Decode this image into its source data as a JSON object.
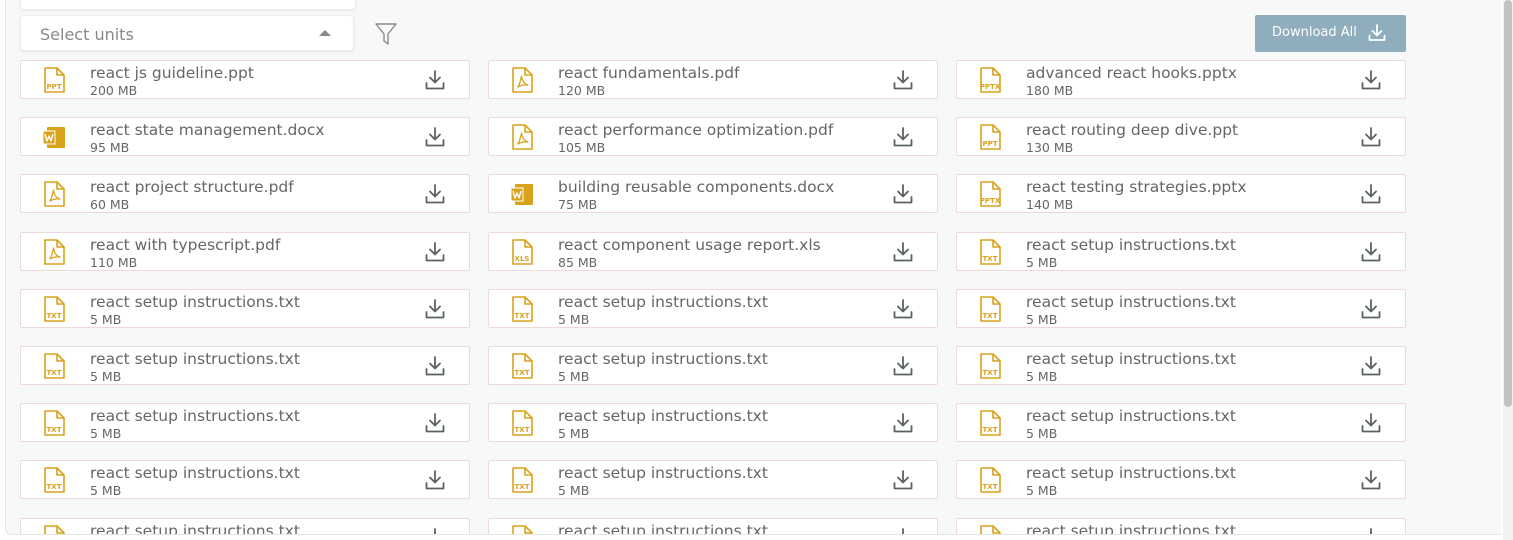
{
  "toolbar": {
    "select_placeholder": "Select units",
    "download_all_label": "Download All",
    "filter_icon": "filter-icon"
  },
  "colors": {
    "accent_button": "#8fadbc",
    "file_icon": "#d9a21b",
    "card_border": "#eed9da",
    "text": "#666666"
  },
  "files": [
    {
      "name": "react js guideline.ppt",
      "size": "200 MB",
      "type": "ppt"
    },
    {
      "name": "react fundamentals.pdf",
      "size": "120 MB",
      "type": "pdf"
    },
    {
      "name": "advanced react hooks.pptx",
      "size": "180 MB",
      "type": "pptx"
    },
    {
      "name": "react state management.docx",
      "size": "95 MB",
      "type": "docx"
    },
    {
      "name": "react performance optimization.pdf",
      "size": "105 MB",
      "type": "pdf"
    },
    {
      "name": "react routing deep dive.ppt",
      "size": "130 MB",
      "type": "ppt"
    },
    {
      "name": "react project structure.pdf",
      "size": "60 MB",
      "type": "pdf"
    },
    {
      "name": "building reusable components.docx",
      "size": "75 MB",
      "type": "docx"
    },
    {
      "name": "react testing strategies.pptx",
      "size": "140 MB",
      "type": "pptx"
    },
    {
      "name": "react with typescript.pdf",
      "size": "110 MB",
      "type": "pdf"
    },
    {
      "name": "react component usage report.xls",
      "size": "85 MB",
      "type": "xls"
    },
    {
      "name": "react setup instructions.txt",
      "size": "5 MB",
      "type": "txt"
    },
    {
      "name": "react setup instructions.txt",
      "size": "5 MB",
      "type": "txt"
    },
    {
      "name": "react setup instructions.txt",
      "size": "5 MB",
      "type": "txt"
    },
    {
      "name": "react setup instructions.txt",
      "size": "5 MB",
      "type": "txt"
    },
    {
      "name": "react setup instructions.txt",
      "size": "5 MB",
      "type": "txt"
    },
    {
      "name": "react setup instructions.txt",
      "size": "5 MB",
      "type": "txt"
    },
    {
      "name": "react setup instructions.txt",
      "size": "5 MB",
      "type": "txt"
    },
    {
      "name": "react setup instructions.txt",
      "size": "5 MB",
      "type": "txt"
    },
    {
      "name": "react setup instructions.txt",
      "size": "5 MB",
      "type": "txt"
    },
    {
      "name": "react setup instructions.txt",
      "size": "5 MB",
      "type": "txt"
    },
    {
      "name": "react setup instructions.txt",
      "size": "5 MB",
      "type": "txt"
    },
    {
      "name": "react setup instructions.txt",
      "size": "5 MB",
      "type": "txt"
    },
    {
      "name": "react setup instructions.txt",
      "size": "5 MB",
      "type": "txt"
    },
    {
      "name": "react setup instructions.txt",
      "size": "",
      "type": "txt"
    },
    {
      "name": "react setup instructions.txt",
      "size": "",
      "type": "txt"
    },
    {
      "name": "react setup instructions.txt",
      "size": "",
      "type": "txt"
    }
  ]
}
